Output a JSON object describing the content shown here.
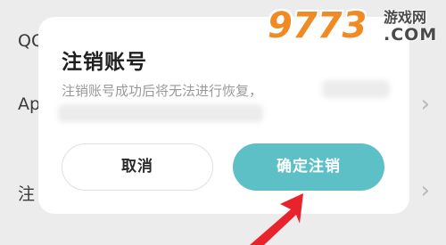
{
  "background_list": {
    "items": [
      {
        "label": "QQ"
      },
      {
        "label": "Apple"
      },
      {
        "label": "注"
      }
    ]
  },
  "dialog": {
    "title": "注销账号",
    "message": "注销账号成功后将无法进行恢复，",
    "cancel_label": "取消",
    "confirm_label": "确定注销"
  },
  "watermark": {
    "number": "9773",
    "site_name": "游戏网",
    "domain": ".COM"
  },
  "colors": {
    "confirm_button": "#5cc0c6",
    "cancel_border": "#e0e0e0",
    "annotation_arrow": "#e8232b",
    "watermark_orange": "#f08a24",
    "dim_background": "#ececec"
  }
}
